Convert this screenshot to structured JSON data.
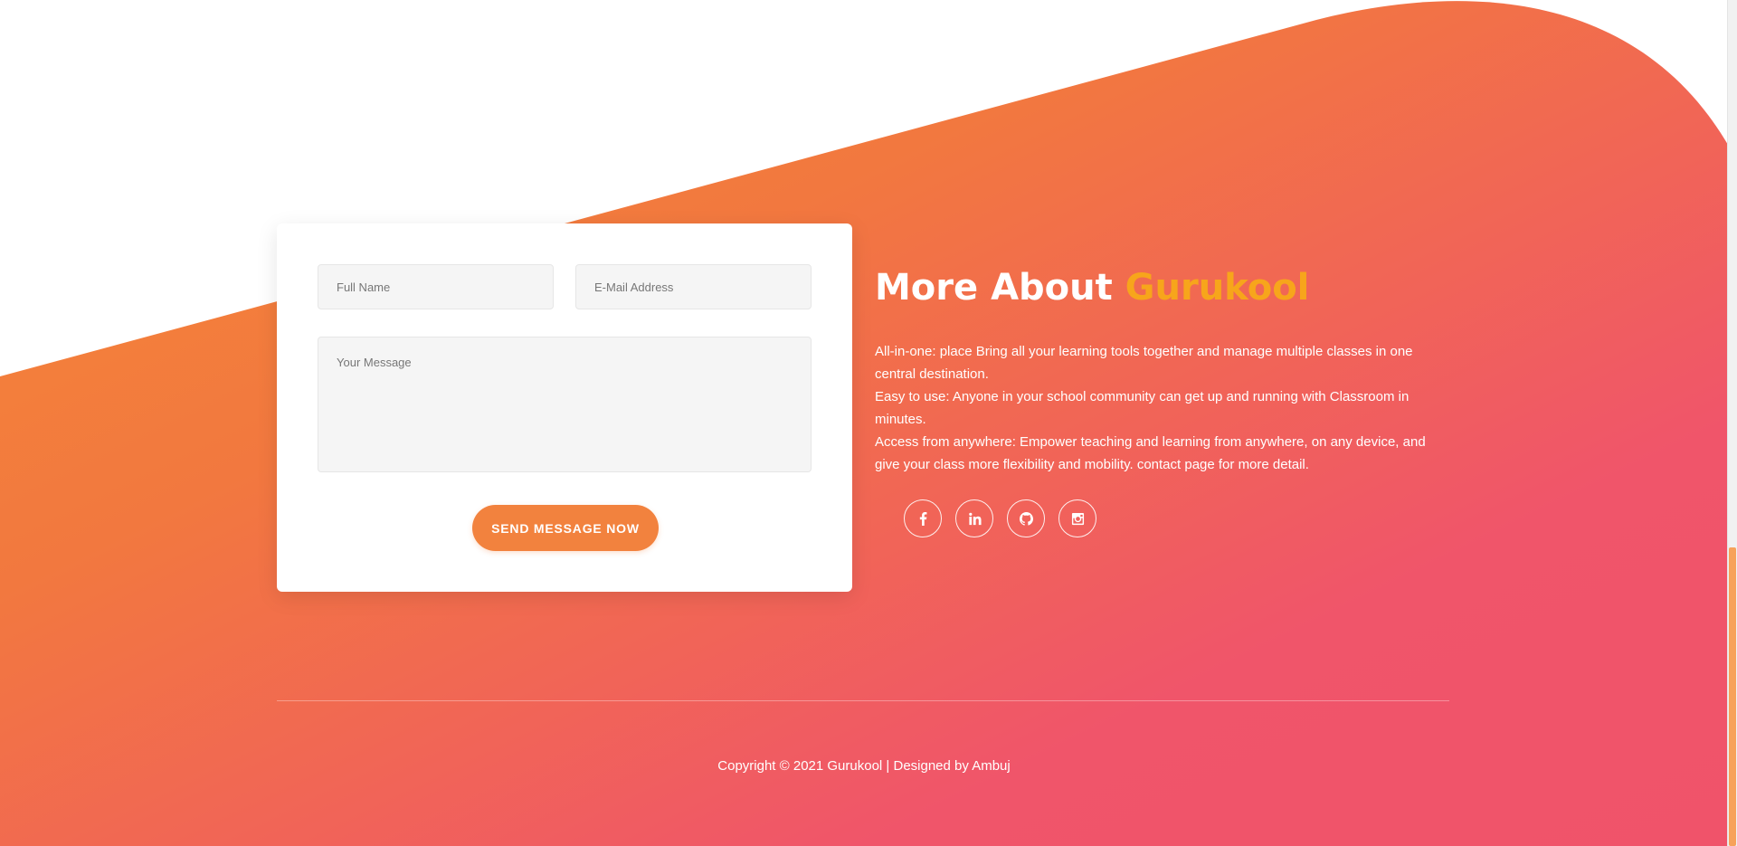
{
  "form": {
    "name_placeholder": "Full Name",
    "email_placeholder": "E-Mail Address",
    "message_placeholder": "Your Message",
    "submit_label": "SEND MESSAGE NOW"
  },
  "about": {
    "title_prefix": "More About",
    "title_brand": "Gurukool",
    "paragraphs": [
      "All-in-one: place Bring all your learning tools together and manage multiple classes in one central destination.",
      "Easy to use: Anyone in your school community can get up and running with Classroom in minutes.",
      "Access from anywhere: Empower teaching and learning from anywhere, on any device, and give your class more flexibility and mobility. contact page for more detail."
    ]
  },
  "social": [
    {
      "icon": "facebook-icon"
    },
    {
      "icon": "linkedin-icon"
    },
    {
      "icon": "github-icon"
    },
    {
      "icon": "instagram-icon"
    }
  ],
  "footer": {
    "copyright": "Copyright © 2021 Gurukool | Designed by Ambuj"
  },
  "colors": {
    "gradient_start": "#f2843c",
    "gradient_end": "#f0526a",
    "accent": "#f2823e",
    "brand_text": "#f7a51b"
  }
}
